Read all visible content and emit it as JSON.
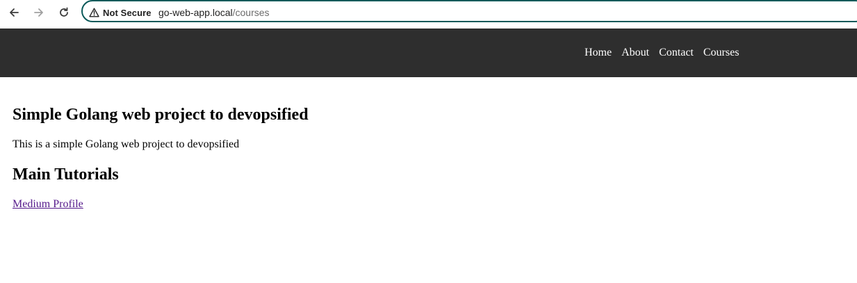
{
  "browser": {
    "back_icon": "arrow-left-icon",
    "forward_icon": "arrow-right-icon",
    "reload_icon": "reload-icon",
    "security_icon": "warning-triangle-icon",
    "security_label": "Not Secure",
    "url_host": "go-web-app.local",
    "url_path": "/courses",
    "accent_color": "#0b5a5a"
  },
  "header": {
    "background_color": "#2e2e2e",
    "nav": [
      "Home",
      "About",
      "Contact",
      "Courses"
    ]
  },
  "main": {
    "title": "Simple Golang web project to devopsified",
    "intro": "This is a simple Golang web project to devopsified",
    "tutorials_heading": "Main Tutorials",
    "link_label": "Medium Profile",
    "link_color": "#551a8b"
  }
}
